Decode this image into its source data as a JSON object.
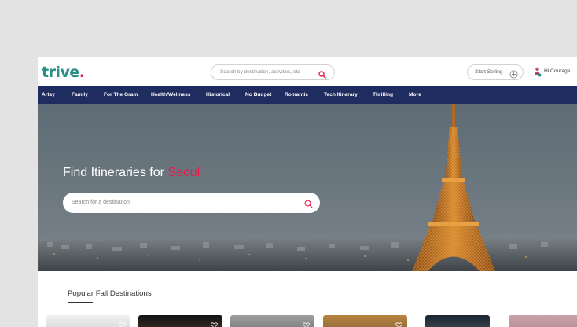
{
  "brand": {
    "logo_text": "trive",
    "logo_dot": ".",
    "primary_color": "#2a8f86",
    "accent_color": "#e51d48",
    "nav_color": "#1f2c5f"
  },
  "header": {
    "search_placeholder": "Search by destination, activities, etc",
    "start_selling_label": "Start Selling",
    "greeting": "Hi Courage"
  },
  "nav": {
    "items": [
      "Artsy",
      "Family",
      "For The Gram",
      "Health/Wellness",
      "Historical",
      "No Budget",
      "Romantic",
      "Tech Itinerary",
      "Thrilling",
      "More"
    ]
  },
  "hero": {
    "title_prefix": "Find Itineraries for ",
    "city": "Seoul",
    "search_placeholder": "Search for a destination"
  },
  "section": {
    "title": "Popular Fall Destinations"
  },
  "icons": [
    "search-icon",
    "plus-circle-icon",
    "user-avatar-icon",
    "chevron-down-icon",
    "heart-icon"
  ]
}
